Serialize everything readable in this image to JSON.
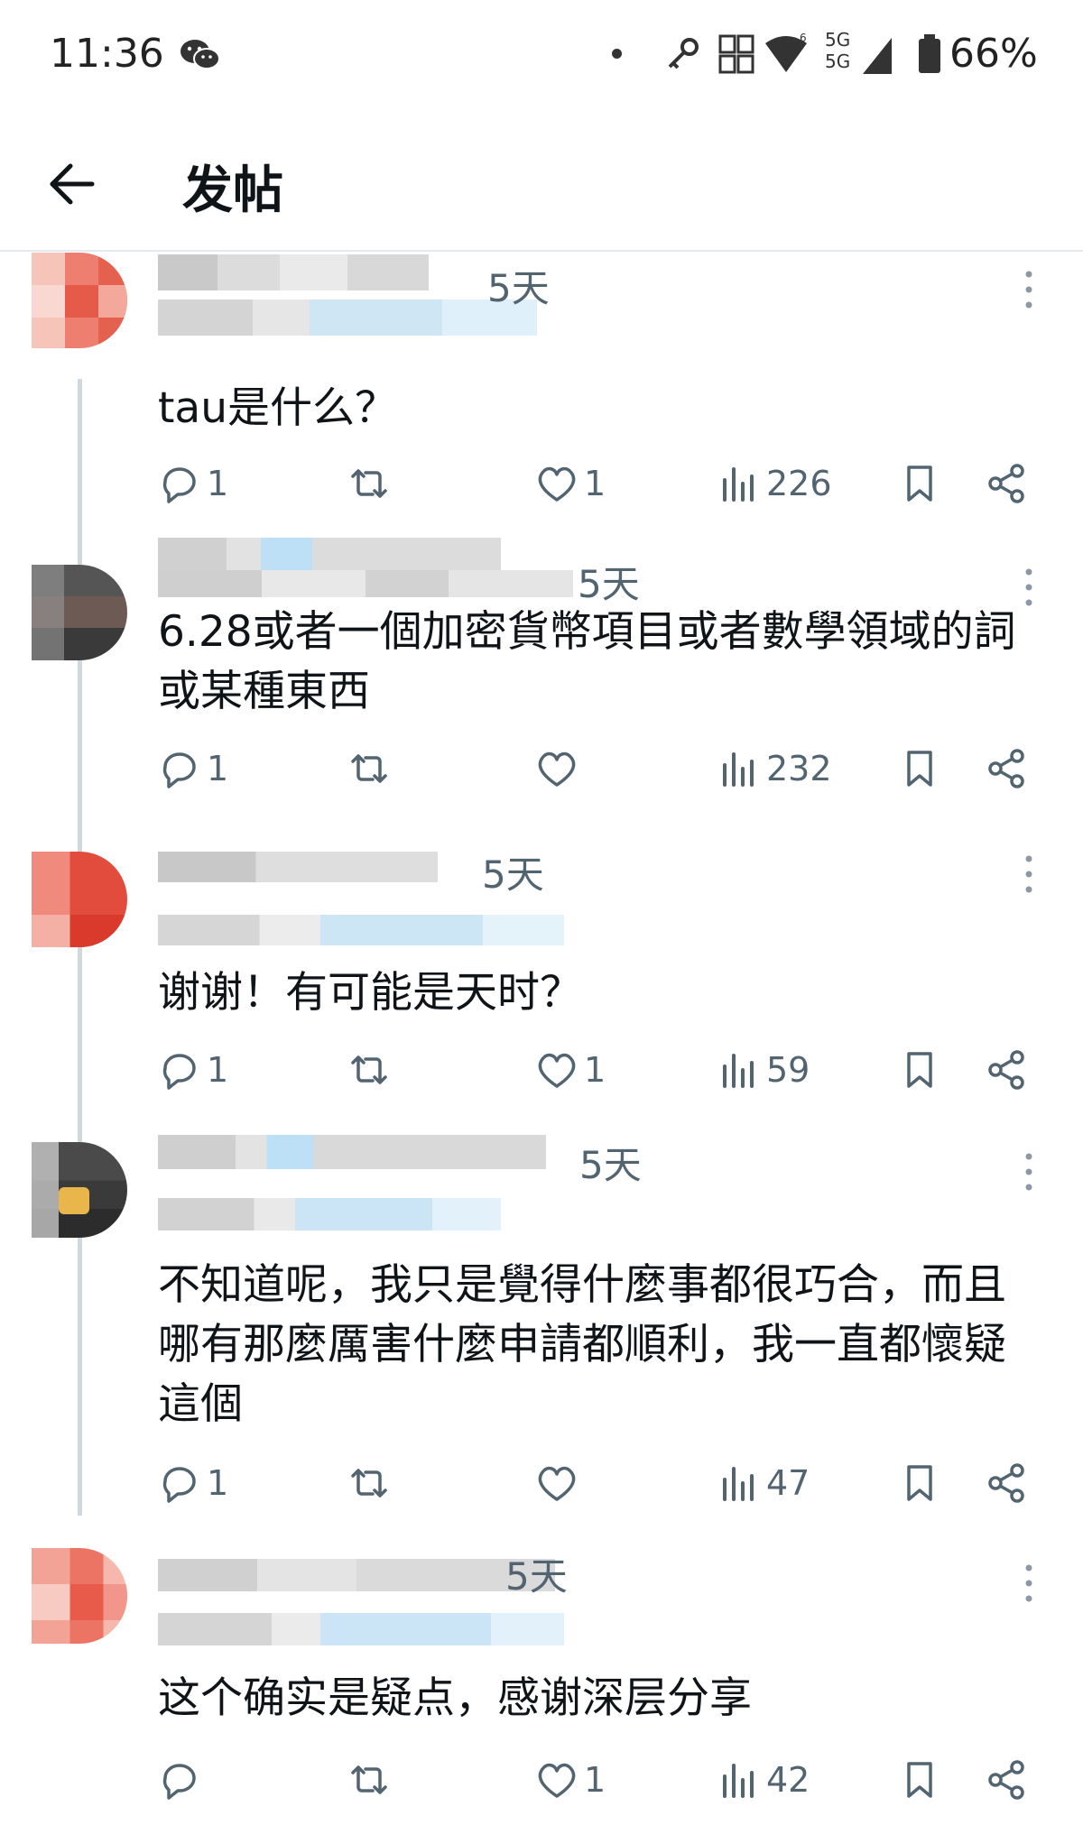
{
  "status_bar": {
    "time": "11:36",
    "network": "5G",
    "battery": "66%"
  },
  "header": {
    "title": "发帖"
  },
  "replies": [
    {
      "time": "5天",
      "text": "tau是什么？",
      "replies": "1",
      "likes": "1",
      "views": "226"
    },
    {
      "time": "5天",
      "text": "6.28或者一個加密貨幣項目或者數學領域的詞或某種東西",
      "replies": "1",
      "likes": "",
      "views": "232"
    },
    {
      "time": "5天",
      "text": "谢谢！有可能是天时？",
      "replies": "1",
      "likes": "1",
      "views": "59"
    },
    {
      "time": "5天",
      "text": "不知道呢，我只是覺得什麼事都很巧合，而且哪有那麼厲害什麼申請都順利，我一直都懷疑這個",
      "replies": "1",
      "likes": "",
      "views": "47"
    },
    {
      "time": "5天",
      "text": "这个确实是疑点，感谢深层分享",
      "replies": "",
      "likes": "1",
      "views": "42"
    }
  ]
}
